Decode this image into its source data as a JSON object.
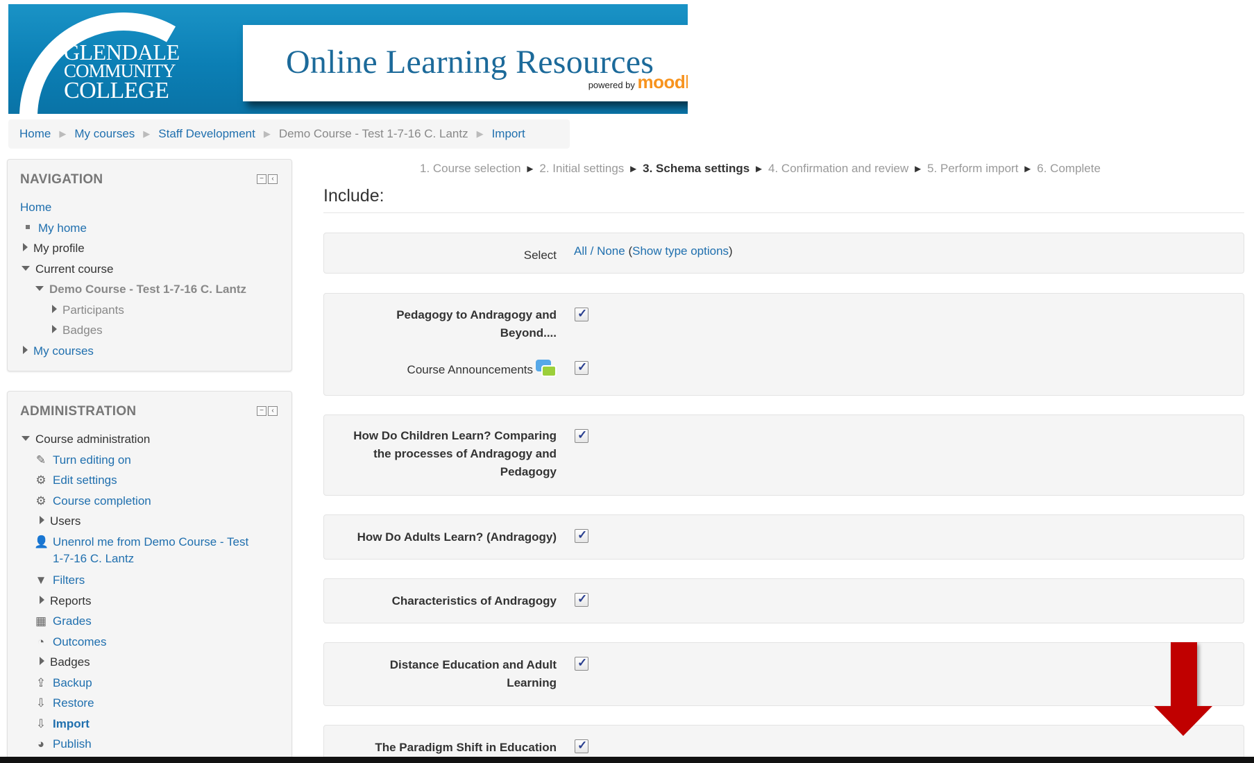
{
  "banner": {
    "college_line1": "GLENDALE",
    "college_line2": "COMMUNITY",
    "college_line3": "COLLEGE",
    "title": "Online Learning Resources",
    "powered_by": "powered by",
    "moodle": "moodle"
  },
  "breadcrumb": [
    {
      "label": "Home"
    },
    {
      "label": "My courses"
    },
    {
      "label": "Staff Development"
    },
    {
      "label": "Demo Course - Test 1-7-16 C. Lantz"
    },
    {
      "label": "Import"
    }
  ],
  "navigation": {
    "title": "NAVIGATION",
    "home": "Home",
    "my_home": "My home",
    "my_profile": "My profile",
    "current_course": "Current course",
    "course_name": "Demo Course - Test 1-7-16 C. Lantz",
    "participants": "Participants",
    "badges": "Badges",
    "my_courses": "My courses"
  },
  "administration": {
    "title": "ADMINISTRATION",
    "course_admin": "Course administration",
    "items": [
      {
        "label": "Turn editing on",
        "icon": "pencil-icon"
      },
      {
        "label": "Edit settings",
        "icon": "gear-icon"
      },
      {
        "label": "Course completion",
        "icon": "gear-icon"
      },
      {
        "label": "Users",
        "icon": "triangle-right-icon"
      },
      {
        "label": "Unenrol me from Demo Course - Test",
        "label2": "1-7-16 C. Lantz",
        "icon": "user-icon"
      },
      {
        "label": "Filters",
        "icon": "filter-icon"
      },
      {
        "label": "Reports",
        "icon": "triangle-right-icon"
      },
      {
        "label": "Grades",
        "icon": "grades-table-icon"
      },
      {
        "label": "Outcomes",
        "icon": "outcomes-icon"
      },
      {
        "label": "Badges",
        "icon": "triangle-right-icon"
      },
      {
        "label": "Backup",
        "icon": "backup-icon"
      },
      {
        "label": "Restore",
        "icon": "restore-icon"
      },
      {
        "label": "Import",
        "icon": "import-icon"
      },
      {
        "label": "Publish",
        "icon": "publish-icon"
      }
    ]
  },
  "steps": {
    "s1": "1. Course selection",
    "s2": "2. Initial settings",
    "s3": "3. Schema settings",
    "s4": "4. Confirmation and review",
    "s5": "5. Perform import",
    "s6": "6. Complete",
    "arrow": "►"
  },
  "include": {
    "heading": "Include:",
    "select_label": "Select",
    "all": "All",
    "slash": " / ",
    "none": "None",
    "open_paren": " (",
    "show_type_options": "Show type options",
    "close_paren": ")"
  },
  "sections": {
    "s1_line1": "Pedagogy to Andragogy and",
    "s1_line2": "Beyond....",
    "s1_activity": "Course Announcements",
    "s2_line1": "How Do Children Learn? Comparing",
    "s2_line2": "the processes of Andragogy and",
    "s2_line3": "Pedagogy",
    "s3": "How Do Adults Learn? (Andragogy)",
    "s4": "Characteristics of Andragogy",
    "s5_line1": "Distance Education and Adult",
    "s5_line2": "Learning",
    "s6": "The Paradigm Shift in Education"
  },
  "colors": {
    "link": "#1f6fae",
    "banner_blue": "#0b7fb5",
    "arrow_red": "#c00000",
    "moodle_orange": "#f7931e"
  }
}
